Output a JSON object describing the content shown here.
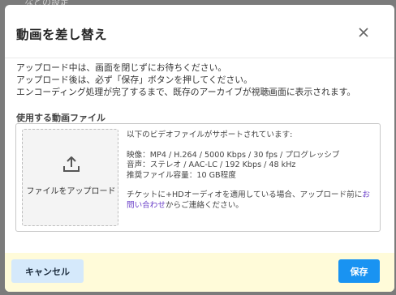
{
  "background": {
    "partial_text": "などの設定"
  },
  "modal": {
    "title": "動画を差し替え",
    "close_icon": "close-icon",
    "notice": [
      "アップロード中は、画面を閉じずにお待ちください。",
      "アップロード後は、必ず「保存」ボタンを押してください。",
      "エンコーディング処理が完了するまで、既存のアーカイブが視聴画面に表示されます。"
    ],
    "file_section": {
      "label": "使用する動画ファイル",
      "upload_icon": "upload-icon",
      "upload_label": "ファイルをアップロード",
      "info_intro": "以下のビデオファイルがサポートされています:",
      "video_spec": "映像：MP4 / H.264 / 5000 Kbps / 30 fps / プログレッシブ",
      "audio_spec": "音声：ステレオ / AAC-LC / 192 Kbps / 48 kHz",
      "size_spec": "推奨ファイル容量：10 GB程度",
      "note_prefix": "チケットに+HDオーディオを適用している場合、アップロード前に",
      "note_link": "お問い合わせ",
      "note_suffix": "からご連絡ください。"
    },
    "footer": {
      "cancel_label": "キャンセル",
      "save_label": "保存"
    }
  },
  "colors": {
    "overlay": "#7b7b7b",
    "footer_bg": "#fffbd9",
    "cancel_bg": "#d5e9fb",
    "save_bg": "#1993f2",
    "link": "#6a3fc8"
  }
}
